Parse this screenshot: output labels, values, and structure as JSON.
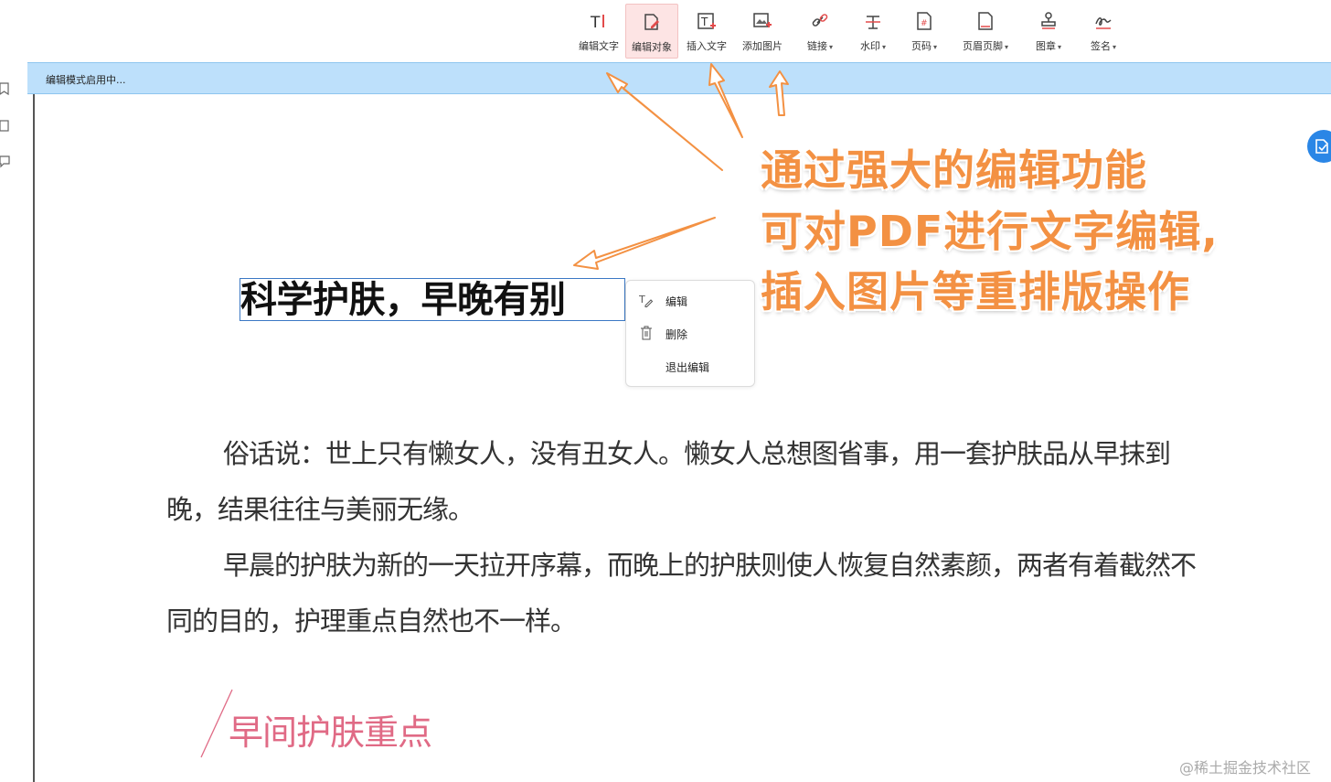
{
  "toolbar": {
    "tools": [
      {
        "label": "编辑文字",
        "icon": "edit-text-icon"
      },
      {
        "label": "编辑对象",
        "icon": "edit-object-icon",
        "active": true
      },
      {
        "label": "插入文字",
        "icon": "insert-text-icon"
      },
      {
        "label": "添加图片",
        "icon": "add-image-icon"
      },
      {
        "label": "链接",
        "icon": "link-icon",
        "dropdown": true
      },
      {
        "label": "水印",
        "icon": "watermark-icon",
        "dropdown": true
      },
      {
        "label": "页码",
        "icon": "page-number-icon",
        "dropdown": true
      },
      {
        "label": "页眉页脚",
        "icon": "header-footer-icon",
        "dropdown": true
      },
      {
        "label": "图章",
        "icon": "stamp-icon",
        "dropdown": true
      },
      {
        "label": "签名",
        "icon": "signature-icon",
        "dropdown": true
      }
    ],
    "caret": "▾"
  },
  "status": {
    "text": "编辑模式启用中..."
  },
  "document": {
    "title": "科学护肤，早晚有别",
    "paragraph1": "俗话说：世上只有懒女人，没有丑女人。懒女人总想图省事，用一套护肤品从早抹到晚，结果往往与美丽无缘。",
    "paragraph2": "早晨的护肤为新的一天拉开序幕，而晚上的护肤则使人恢复自然素颜，两者有着截然不同的目的，护理重点自然也不一样。",
    "section_heading": "早间护肤重点"
  },
  "context_menu": {
    "items": [
      {
        "label": "编辑",
        "icon": "edit-pen-icon"
      },
      {
        "label": "删除",
        "icon": "trash-icon"
      },
      {
        "label": "退出编辑",
        "icon": ""
      }
    ]
  },
  "annotation": {
    "line1": "通过强大的编辑功能",
    "line2": "可对PDF进行文字编辑,",
    "line3": "插入图片等重排版操作",
    "color": "#f39143"
  },
  "watermark": "@稀土掘金技术社区",
  "colors": {
    "accent": "#2a86e6",
    "active_tool_bg": "#fde4e4",
    "status_bar": "#bde0fb",
    "section_pink": "#e06a85"
  }
}
